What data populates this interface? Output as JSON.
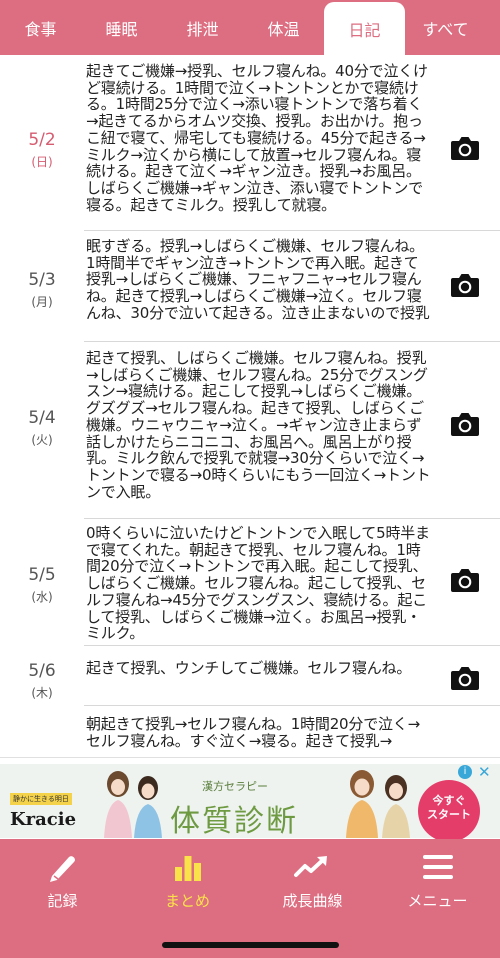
{
  "tabs": [
    {
      "label": "食事"
    },
    {
      "label": "睡眠"
    },
    {
      "label": "排泄"
    },
    {
      "label": "体温"
    },
    {
      "label": "日記"
    },
    {
      "label": "すべて"
    }
  ],
  "entries": [
    {
      "date": "5/2",
      "weekday": "(日)",
      "text": "起きてご機嫌→授乳、セルフ寝んね。40分で泣くけど寝続ける。1時間で泣く→トントンとかで寝続ける。1時間25分で泣く→添い寝トントンで落ち着く→起きてるからオムツ交換、授乳。お出かけ。抱っこ紐で寝て、帰宅しても寝続ける。45分で起きる→ミルク→泣くから横にして放置→セルフ寝んね。寝続ける。起きて泣く→ギャン泣き。授乳→お風呂。しばらくご機嫌→ギャン泣き、添い寝でトントンで寝る。起きてミルク。授乳して就寝。"
    },
    {
      "date": "5/3",
      "weekday": "(月)",
      "text": "眠すぎる。授乳→しばらくご機嫌、セルフ寝んね。1時間半でギャン泣き→トントンで再入眠。起きて授乳→しばらくご機嫌、フニャフニャ→セルフ寝んね。起きて授乳→しばらくご機嫌→泣く。セルフ寝んね、30分で泣いて起きる。泣き止まないので授乳"
    },
    {
      "date": "5/4",
      "weekday": "(火)",
      "text": "起きて授乳、しばらくご機嫌。セルフ寝んね。授乳→しばらくご機嫌、セルフ寝んね。25分でグスングスン→寝続ける。起こして授乳→しばらくご機嫌。グズグズ→セルフ寝んね。起きて授乳、しばらくご機嫌。ウニャウニャ→泣く。→ギャン泣き止まらず話しかけたらニコニコ、お風呂へ。風呂上がり授乳。ミルク飲んで授乳で就寝→30分くらいで泣く→トントンで寝る→0時くらいにもう一回泣く→トントンで入眠。"
    },
    {
      "date": "5/5",
      "weekday": "(水)",
      "text": "0時くらいに泣いたけどトントンで入眠して5時半まで寝てくれた。朝起きて授乳、セルフ寝んね。1時間20分で泣く→トントンで再入眠。起こして授乳、しばらくご機嫌。セルフ寝んね。起こして授乳、セルフ寝んね→45分でグスングスン、寝続ける。起こして授乳、しばらくご機嫌→泣く。お風呂→授乳・ミルク。"
    },
    {
      "date": "5/6",
      "weekday": "(木)",
      "text": "起きて授乳、ウンチしてご機嫌。セルフ寝んね。"
    },
    {
      "date": "",
      "weekday": "",
      "text": "朝起きて授乳→セルフ寝んね。1時間20分で泣く→セルフ寝んね。すぐ泣く→寝る。起きて授乳→"
    }
  ],
  "icons": {
    "camera": "camera-icon"
  },
  "ad": {
    "slogan": "静かに生きる明日",
    "brand": "Kracie",
    "sub": "漢方セラピー",
    "title": "体質診断",
    "cta_line1": "今すぐ",
    "cta_line2": "スタート",
    "info": "i",
    "close": "✕"
  },
  "nav": [
    {
      "label": "記録",
      "icon": "pencil-icon"
    },
    {
      "label": "まとめ",
      "icon": "bar-chart-icon"
    },
    {
      "label": "成長曲線",
      "icon": "trend-line-icon"
    },
    {
      "label": "メニュー",
      "icon": "menu-icon"
    }
  ],
  "colors": {
    "brand": "#dd6d80",
    "active_nav": "#f9e24a",
    "highlight_date": "#d65c70"
  }
}
